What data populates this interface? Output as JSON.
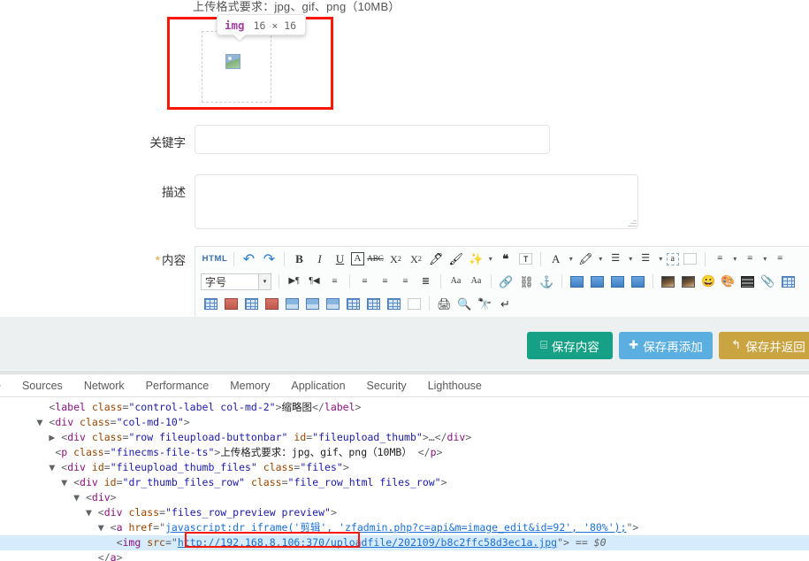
{
  "page": {
    "upload_hint": "上传格式要求：jpg、gif、png（10MB）"
  },
  "tooltip": {
    "tag": "img",
    "dimensions": "16 × 16"
  },
  "fields": [
    {
      "label": "关键字",
      "required": false,
      "value": "",
      "placeholder": ""
    },
    {
      "label": "描述",
      "required": false,
      "value": "",
      "placeholder": ""
    },
    {
      "label": "内容",
      "required": true,
      "required_mark": "*"
    }
  ],
  "editor": {
    "html_button": "HTML",
    "font_size_select": "字号",
    "row1": [
      "undo-icon",
      "redo-icon",
      "bold-icon",
      "italic-icon",
      "underline-icon",
      "font-box-icon",
      "strikethrough-icon",
      "superscript-icon",
      "subscript-icon",
      "eraser-icon",
      "brush-icon",
      "magic-wand-icon",
      "quote-icon",
      "paste-text-icon",
      "text-color-icon",
      "bg-color-icon",
      "ordered-list-icon",
      "unordered-list-icon",
      "remove-format-icon",
      "page-break-icon",
      "line-height-icon",
      "paragraph-spacing-icon",
      "indent-spacing-icon"
    ],
    "row2": [
      "ltr-icon",
      "rtl-icon",
      "indent-icon",
      "align-left-icon",
      "align-center-icon",
      "align-right-icon",
      "align-justify-icon",
      "increase-font-icon",
      "decrease-font-icon",
      "link-icon",
      "unlink-icon",
      "anchor-icon",
      "wrap-left-icon",
      "wrap-right-icon",
      "wrap-none-icon",
      "wrap-center-icon",
      "image-icon",
      "multi-image-icon",
      "emoji-icon",
      "palette-icon",
      "video-icon",
      "attachment-icon",
      "gallery-icon"
    ],
    "row3": [
      "insert-table-icon",
      "merge-cells-icon",
      "split-cells-icon",
      "delete-table-icon",
      "table-props-icon",
      "insert-row-icon",
      "insert-col-icon",
      "table-grid-icon",
      "table-rows-icon",
      "table-cols-icon",
      "page-icon",
      "print-icon",
      "preview-icon",
      "search-replace-icon",
      "line-break-icon"
    ]
  },
  "savebar": {
    "buttons": [
      {
        "id": "save",
        "icon": "save-icon",
        "glyph": "⌸",
        "label": "保存内容",
        "color": "#16a085"
      },
      {
        "id": "save_add",
        "icon": "plus-icon",
        "glyph": "➕",
        "label": "保存再添加",
        "color": "#5aaee0"
      },
      {
        "id": "save_back",
        "icon": "back-arrow-icon",
        "glyph": "↶",
        "label": "保存并返回",
        "color": "#c9a441"
      }
    ]
  },
  "devtools": {
    "tabs": [
      "e",
      "Sources",
      "Network",
      "Performance",
      "Memory",
      "Application",
      "Security",
      "Lighthouse"
    ],
    "dom_lines": [
      {
        "indent": 8,
        "parts": [
          {
            "t": "pt",
            "s": "<"
          },
          {
            "t": "tg",
            "s": "label"
          },
          {
            "t": "at",
            "s": " class"
          },
          {
            "t": "pt",
            "s": "="
          },
          {
            "t": "av",
            "s": "\"control-label col-md-2\""
          },
          {
            "t": "pt",
            "s": ">"
          },
          {
            "t": "tx",
            "s": "缩略图"
          },
          {
            "t": "pt",
            "s": "</"
          },
          {
            "t": "tg",
            "s": "label"
          },
          {
            "t": "pt",
            "s": ">"
          }
        ]
      },
      {
        "indent": 6,
        "twisty": "open",
        "parts": [
          {
            "t": "pt",
            "s": "<"
          },
          {
            "t": "tg",
            "s": "div"
          },
          {
            "t": "at",
            "s": " class"
          },
          {
            "t": "pt",
            "s": "="
          },
          {
            "t": "av",
            "s": "\"col-md-10\""
          },
          {
            "t": "pt",
            "s": ">"
          }
        ]
      },
      {
        "indent": 8,
        "twisty": "closed",
        "parts": [
          {
            "t": "pt",
            "s": "<"
          },
          {
            "t": "tg",
            "s": "div"
          },
          {
            "t": "at",
            "s": " class"
          },
          {
            "t": "pt",
            "s": "="
          },
          {
            "t": "av",
            "s": "\"row fileupload-buttonbar\""
          },
          {
            "t": "at",
            "s": " id"
          },
          {
            "t": "pt",
            "s": "="
          },
          {
            "t": "av",
            "s": "\"fileupload_thumb\""
          },
          {
            "t": "pt",
            "s": ">…</"
          },
          {
            "t": "tg",
            "s": "div"
          },
          {
            "t": "pt",
            "s": ">"
          }
        ]
      },
      {
        "indent": 9,
        "parts": [
          {
            "t": "pt",
            "s": "<"
          },
          {
            "t": "tg",
            "s": "p"
          },
          {
            "t": "at",
            "s": " class"
          },
          {
            "t": "pt",
            "s": "="
          },
          {
            "t": "av",
            "s": "\"finecms-file-ts\""
          },
          {
            "t": "pt",
            "s": ">"
          },
          {
            "t": "tx",
            "s": "上传格式要求：jpg、gif、png（10MB）"
          },
          {
            "t": "pt",
            "s": " </"
          },
          {
            "t": "tg",
            "s": "p"
          },
          {
            "t": "pt",
            "s": ">"
          }
        ]
      },
      {
        "indent": 8,
        "twisty": "open",
        "parts": [
          {
            "t": "pt",
            "s": "<"
          },
          {
            "t": "tg",
            "s": "div"
          },
          {
            "t": "at",
            "s": " id"
          },
          {
            "t": "pt",
            "s": "="
          },
          {
            "t": "av",
            "s": "\"fileupload_thumb_files\""
          },
          {
            "t": "at",
            "s": " class"
          },
          {
            "t": "pt",
            "s": "="
          },
          {
            "t": "av",
            "s": "\"files\""
          },
          {
            "t": "pt",
            "s": ">"
          }
        ]
      },
      {
        "indent": 10,
        "twisty": "open",
        "parts": [
          {
            "t": "pt",
            "s": "<"
          },
          {
            "t": "tg",
            "s": "div"
          },
          {
            "t": "at",
            "s": " id"
          },
          {
            "t": "pt",
            "s": "="
          },
          {
            "t": "av",
            "s": "\"dr_thumb_files_row\""
          },
          {
            "t": "at",
            "s": " class"
          },
          {
            "t": "pt",
            "s": "="
          },
          {
            "t": "av",
            "s": "\"file_row_html files_row\""
          },
          {
            "t": "pt",
            "s": ">"
          }
        ]
      },
      {
        "indent": 12,
        "twisty": "open",
        "parts": [
          {
            "t": "pt",
            "s": "<"
          },
          {
            "t": "tg",
            "s": "div"
          },
          {
            "t": "pt",
            "s": ">"
          }
        ]
      },
      {
        "indent": 14,
        "twisty": "open",
        "parts": [
          {
            "t": "pt",
            "s": "<"
          },
          {
            "t": "tg",
            "s": "div"
          },
          {
            "t": "at",
            "s": " class"
          },
          {
            "t": "pt",
            "s": "="
          },
          {
            "t": "av",
            "s": "\"files_row_preview preview\""
          },
          {
            "t": "pt",
            "s": ">"
          }
        ]
      },
      {
        "indent": 16,
        "twisty": "open",
        "parts": [
          {
            "t": "pt",
            "s": "<"
          },
          {
            "t": "tg",
            "s": "a"
          },
          {
            "t": "at",
            "s": " href"
          },
          {
            "t": "pt",
            "s": "=\""
          },
          {
            "t": "lnk",
            "s": "javascript:dr_iframe('剪辑', 'zfadmin.php?c=api&m=image_edit&id=92', '80%');"
          },
          {
            "t": "pt",
            "s": "\">"
          }
        ]
      },
      {
        "indent": 19,
        "selected": true,
        "parts": [
          {
            "t": "pt",
            "s": "<"
          },
          {
            "t": "tg",
            "s": "img"
          },
          {
            "t": "at",
            "s": " src"
          },
          {
            "t": "pt",
            "s": "=\""
          },
          {
            "t": "lnk",
            "s": "http://192.168.8.106:370/uploadfile/202109/b8c2ffc58d3ec1a.jpg"
          },
          {
            "t": "pt",
            "s": "\"> "
          },
          {
            "t": "dollar",
            "s": "== $0"
          }
        ]
      },
      {
        "indent": 16,
        "parts": [
          {
            "t": "pt",
            "s": "</"
          },
          {
            "t": "tg",
            "s": "a"
          },
          {
            "t": "pt",
            "s": ">"
          }
        ]
      }
    ]
  },
  "colors": {
    "highlight_red": "#fa1705",
    "selected_row": "#d6ebfb",
    "save_green": "#16a085",
    "save_blue": "#5aaee0",
    "save_gold": "#c9a441",
    "savebar_bg": "#ecf0f1"
  }
}
